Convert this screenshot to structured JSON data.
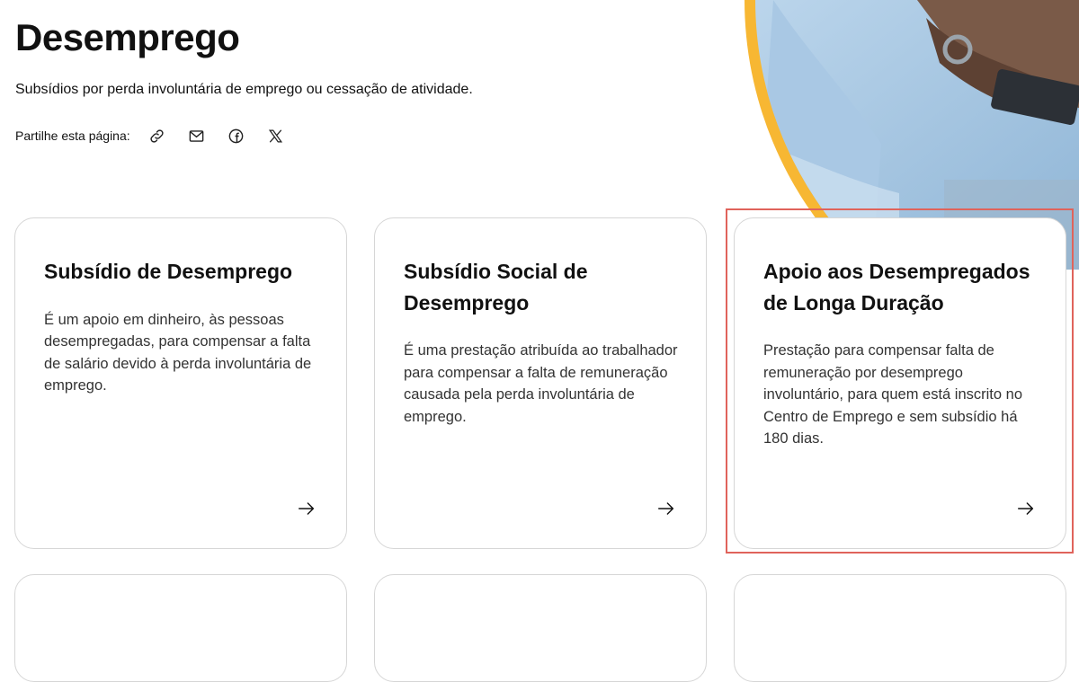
{
  "page": {
    "title": "Desemprego",
    "subtitle": "Subsídios por perda involuntária de emprego ou cessação de atividade."
  },
  "share": {
    "label": "Partilhe esta página:",
    "icons": [
      "link-icon",
      "mail-icon",
      "facebook-icon",
      "x-icon"
    ]
  },
  "cards": [
    {
      "title": "Subsídio de Desemprego",
      "description": "É um apoio em dinheiro, às pessoas desempregadas, para compensar a falta de salário devido à perda involuntária de emprego."
    },
    {
      "title": "Subsídio Social de Desemprego",
      "description": "É uma prestação atribuída ao trabalhador para compensar a falta de remuneração causada pela perda involuntária de emprego."
    },
    {
      "title": "Apoio aos Desempregados de Longa Duração",
      "description": "Prestação para compensar falta de remuneração por desemprego involuntário, para quem está inscrito no Centro de Emprego e sem subsídio há 180 dias."
    }
  ],
  "colors": {
    "accent_yellow": "#f7b733",
    "highlight": "#e0635b",
    "card_border": "#d6d6d6"
  }
}
